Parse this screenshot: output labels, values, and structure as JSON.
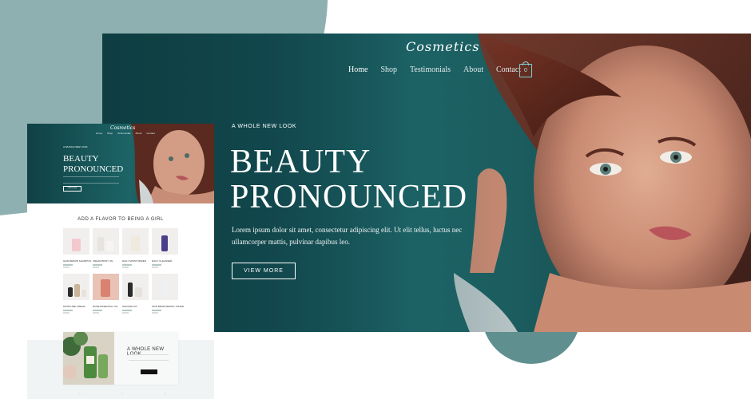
{
  "brand": {
    "logo": "Cosmetics"
  },
  "nav": {
    "items": [
      "Home",
      "Shop",
      "Testimonials",
      "About",
      "Contact"
    ],
    "cart_count": "0"
  },
  "hero": {
    "eyebrow": "A WHOLE NEW LOOK",
    "headline_line1": "BEAUTY",
    "headline_line2": "PRONOUNCED",
    "lede_line1": "Lorem ipsum dolor sit amet, consectetur adipiscing elit. Ut elit tellus, luctus nec",
    "lede_line2": "ullamcorper mattis, pulvinar dapibus leo.",
    "cta": "VIEW MORE"
  },
  "mini": {
    "section_title": "ADD A FLAVOR TO BEING A GIRL",
    "products": [
      "HAIR REPAIR SHAMPOO",
      "CREAM BODY OIL",
      "DAILY MOISTURIZER",
      "DAILY CLEANSER",
      "MOISTURE CREAM",
      "ROSE ESSENTIAL OIL",
      "SHAVING KIT",
      "SKIN BRIGHTENING TONER"
    ],
    "feature_title": "A WHOLE NEW LOOK"
  },
  "colors": {
    "teal_dark": "#0e3e42",
    "teal": "#1f6a6d",
    "sage": "#8fb0b0",
    "accent": "#7fd0d6"
  }
}
